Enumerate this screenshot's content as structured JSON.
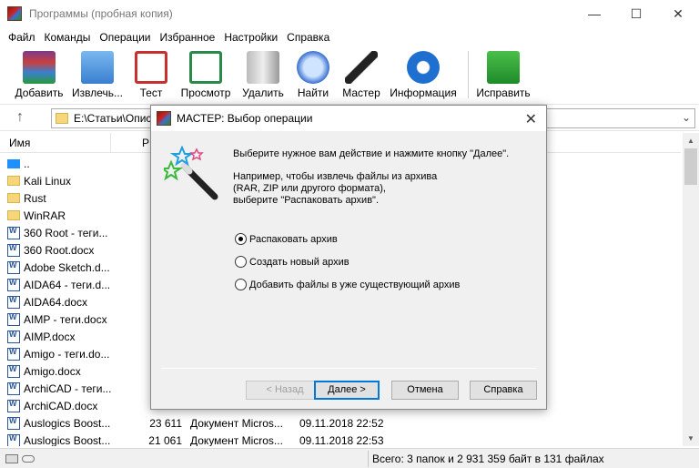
{
  "window": {
    "title": "Программы (пробная копия)",
    "controls": {
      "minimize": "—",
      "maximize": "☐",
      "close": "✕"
    }
  },
  "menu": [
    "Файл",
    "Команды",
    "Операции",
    "Избранное",
    "Настройки",
    "Справка"
  ],
  "toolbar": [
    {
      "label": "Добавить",
      "icon": "add-archive-icon",
      "color": "#7a3a8a"
    },
    {
      "label": "Извлечь...",
      "icon": "extract-folder-icon",
      "color": "#3a7fd0"
    },
    {
      "label": "Тест",
      "icon": "test-clipboard-icon",
      "color": "#c83030"
    },
    {
      "label": "Просмотр",
      "icon": "view-book-icon",
      "color": "#2a8a4a"
    },
    {
      "label": "Удалить",
      "icon": "trash-icon",
      "color": "#888888"
    },
    {
      "label": "Найти",
      "icon": "magnifier-icon",
      "color": "#3a6fd0"
    },
    {
      "label": "Мастер",
      "icon": "wizard-wand-icon",
      "color": "#222222"
    },
    {
      "label": "Информация",
      "icon": "info-icon",
      "color": "#1e6fd0"
    },
    {
      "label": "Исправить",
      "icon": "repair-kit-icon",
      "color": "#2a9a3a"
    }
  ],
  "address": {
    "path": "E:\\Статьи\\Опис"
  },
  "columns": {
    "name": "Имя",
    "size": "Р"
  },
  "files": [
    {
      "name": "..",
      "type": "up"
    },
    {
      "name": "Kali Linux",
      "type": "folder"
    },
    {
      "name": "Rust",
      "type": "folder"
    },
    {
      "name": "WinRAR",
      "type": "folder"
    },
    {
      "name": "360 Root - теги...",
      "type": "doc"
    },
    {
      "name": "360 Root.docx",
      "type": "doc"
    },
    {
      "name": "Adobe Sketch.d...",
      "type": "doc"
    },
    {
      "name": "AIDA64 - теги.d...",
      "type": "doc"
    },
    {
      "name": "AIDA64.docx",
      "type": "doc"
    },
    {
      "name": "AIMP - теги.docx",
      "type": "doc"
    },
    {
      "name": "AIMP.docx",
      "type": "doc"
    },
    {
      "name": "Amigo - теги.do...",
      "type": "doc"
    },
    {
      "name": "Amigo.docx",
      "type": "doc"
    },
    {
      "name": "ArchiCAD - теги...",
      "type": "doc"
    },
    {
      "name": "ArchiCAD.docx",
      "type": "doc"
    },
    {
      "name": "Auslogics Boost...",
      "type": "doc",
      "size": "23 611",
      "doctype": "Документ Micros...",
      "date": "09.11.2018 22:52"
    },
    {
      "name": "Auslogics Boost...",
      "type": "doc",
      "size": "21 061",
      "doctype": "Документ Micros...",
      "date": "09.11.2018 22:53"
    }
  ],
  "status": {
    "text": "Всего: 3 папок и 2 931 359 байт в 131 файлах"
  },
  "dialog": {
    "title": "МАСТЕР: Выбор операции",
    "instruction": "Выберите нужное вам действие и нажмите кнопку \"Далее\".",
    "example_lines": [
      "Например, чтобы извлечь файлы из архива",
      "(RAR, ZIP или другого формата),",
      "выберите \"Распаковать архив\"."
    ],
    "options": [
      {
        "label": "Распаковать архив",
        "selected": true
      },
      {
        "label": "Создать новый архив",
        "selected": false
      },
      {
        "label": "Добавить файлы в уже существующий архив",
        "selected": false
      }
    ],
    "buttons": {
      "back": "< Назад",
      "next": "Далее >",
      "cancel": "Отмена",
      "help": "Справка"
    }
  }
}
